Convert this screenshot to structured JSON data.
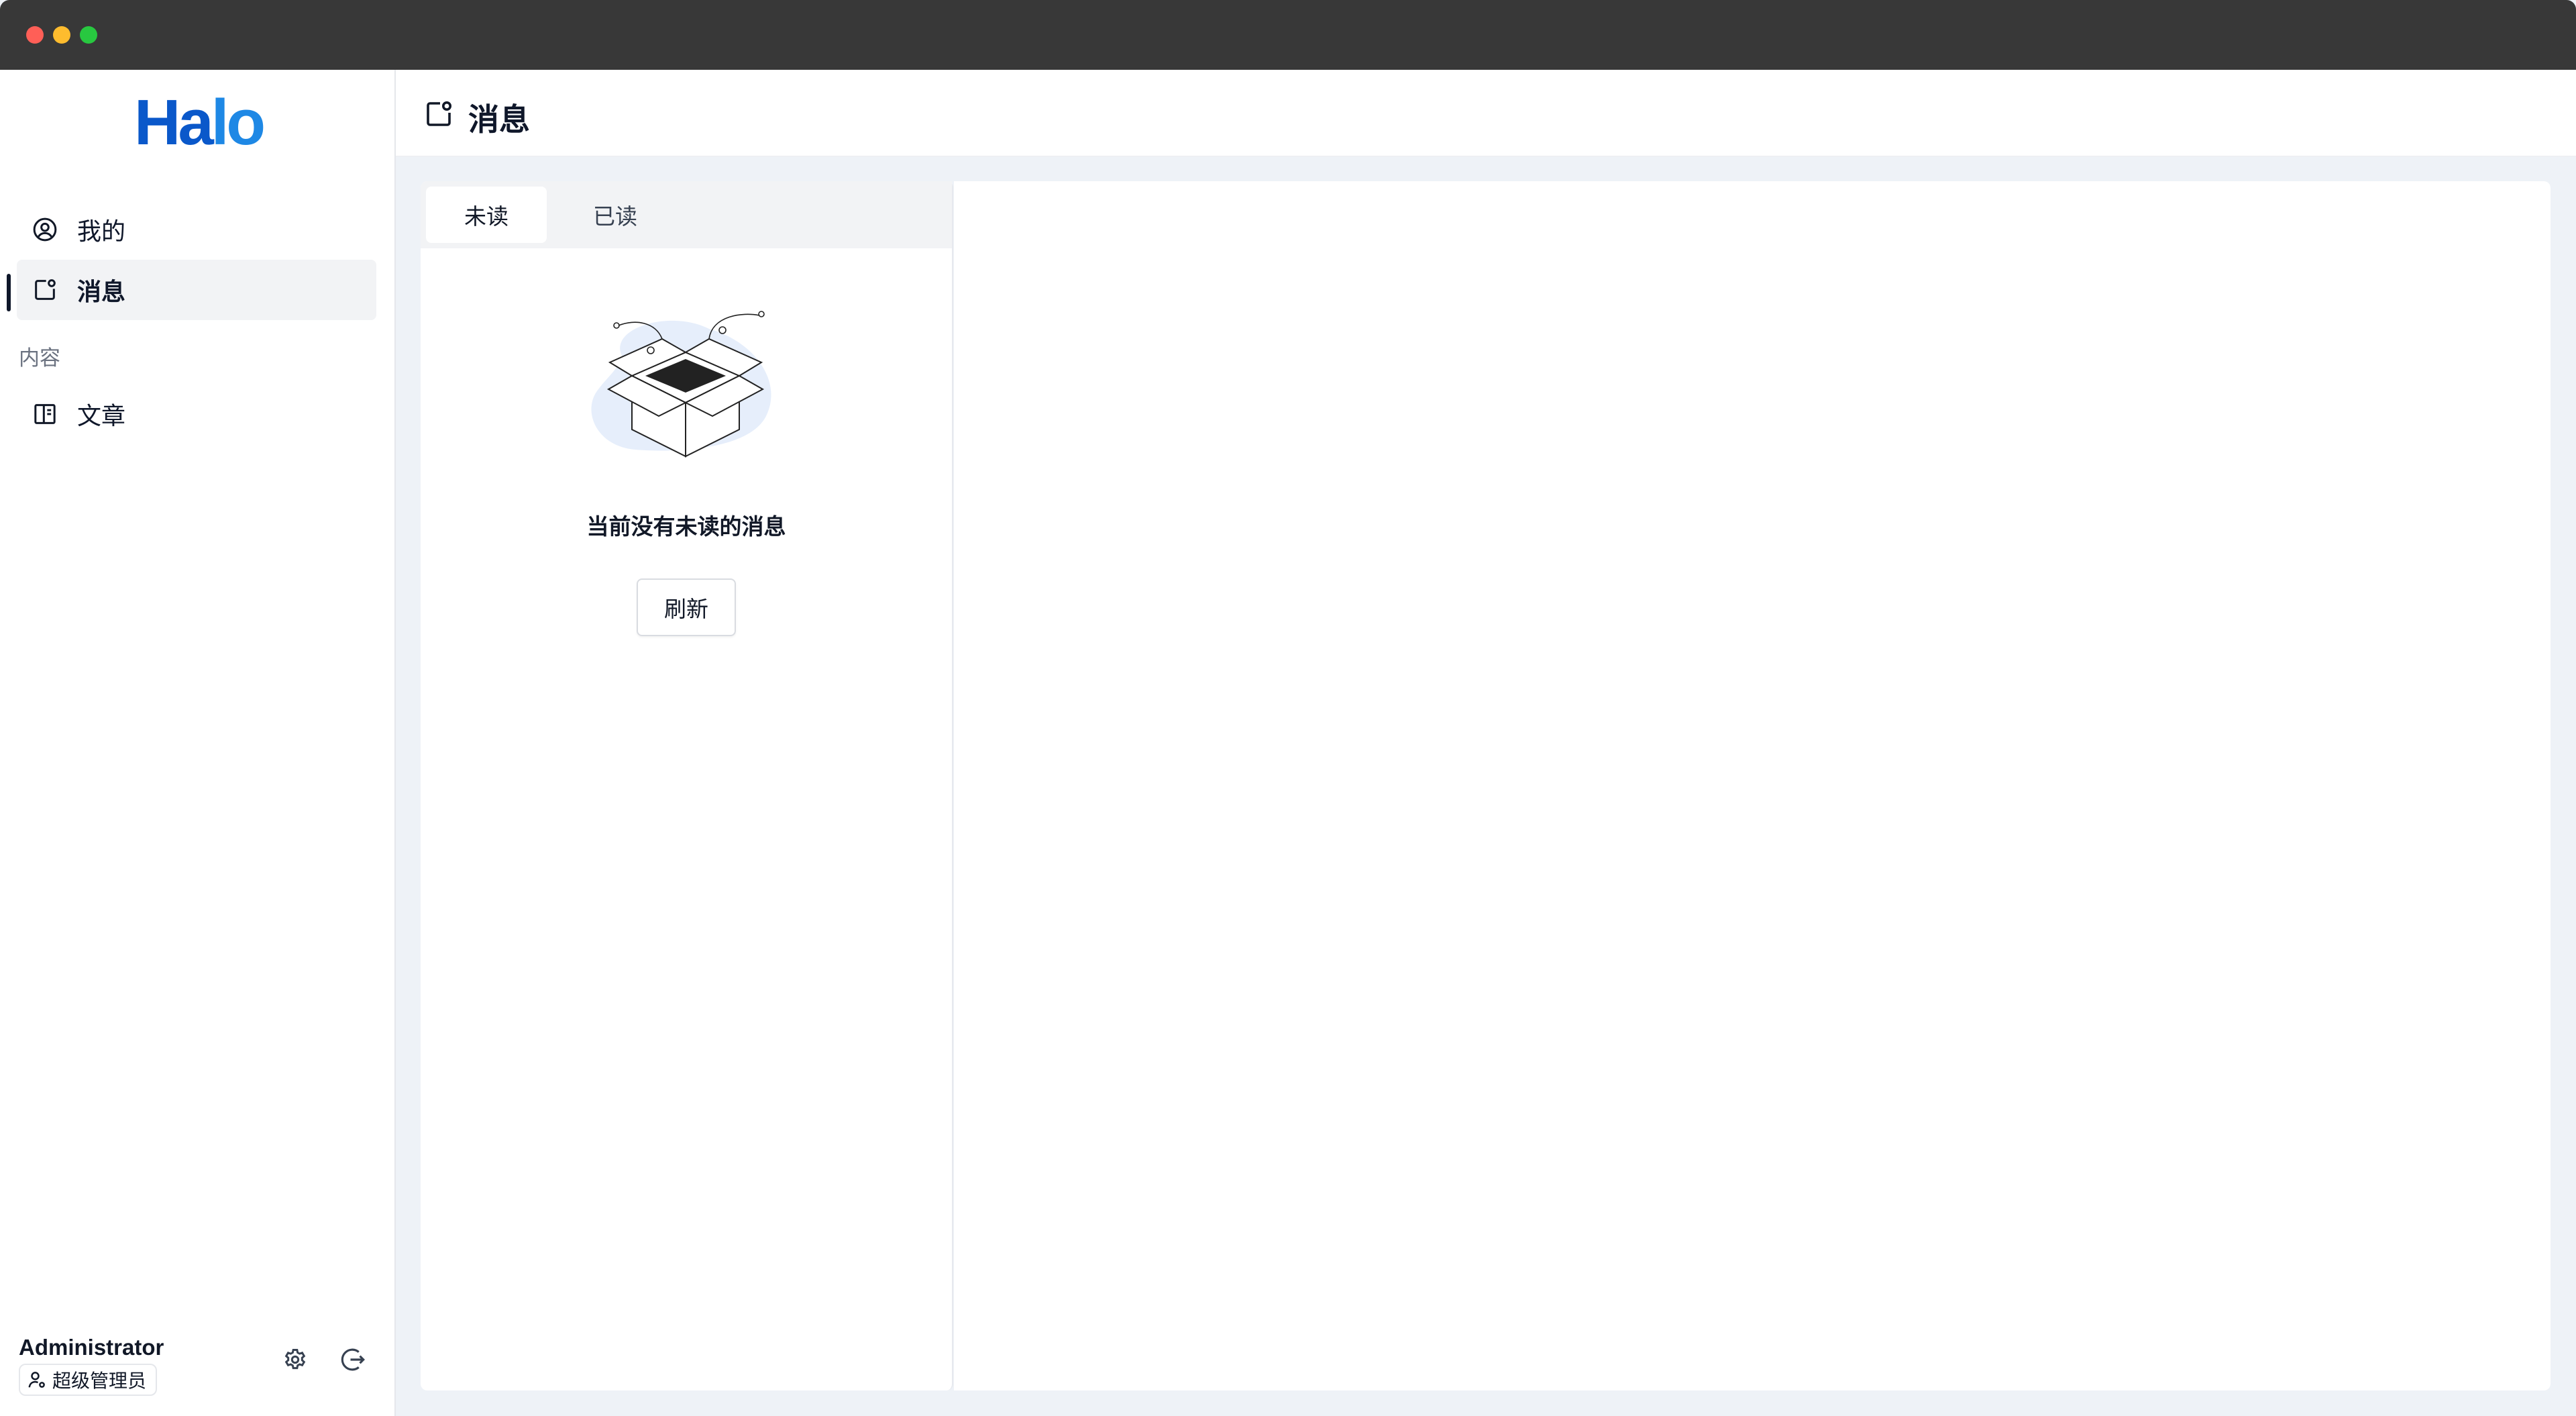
{
  "window": {
    "controls": [
      "close",
      "minimize",
      "maximize"
    ]
  },
  "sidebar": {
    "logo": {
      "part1": "Ha",
      "part2": "lo"
    },
    "items": [
      {
        "label": "我的",
        "icon": "user-circle-icon"
      },
      {
        "label": "消息",
        "icon": "notification-icon",
        "active": true
      }
    ],
    "group_label": "内容",
    "group_items": [
      {
        "label": "文章",
        "icon": "book-icon"
      }
    ],
    "user": {
      "name": "Administrator",
      "role": "超级管理员"
    }
  },
  "header": {
    "title": "消息",
    "icon": "notification-icon"
  },
  "tabs": [
    {
      "label": "未读",
      "active": true
    },
    {
      "label": "已读",
      "active": false
    }
  ],
  "empty_state": {
    "message": "当前没有未读的消息",
    "button_label": "刷新"
  },
  "colors": {
    "brand": "#0a58ca",
    "active_bg": "#f2f3f5",
    "page_bg": "#eef2f7"
  }
}
